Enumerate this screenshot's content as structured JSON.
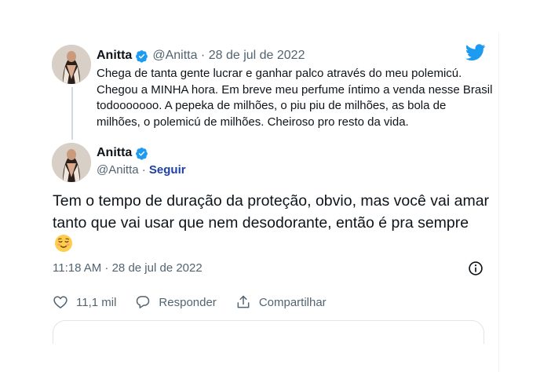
{
  "colors": {
    "accent": "#1d9bf0",
    "text": "#0f1419",
    "muted": "#536471",
    "link": "#1d3fa8"
  },
  "parent_tweet": {
    "author_name": "Anitta",
    "handle_date": "@Anitta · 28 de jul de 2022",
    "text": "Chega de tanta gente lucrar e ganhar palco através do meu polemicú. Chegou a MINHA hora. Em breve meu perfume íntimo a venda nesse Brasil todooooooo. A pepeka de milhões, o piu piu de milhões, as bola de milhões, o polemicú de milhões. Cheiroso pro resto da vida."
  },
  "main_tweet": {
    "author_name": "Anitta",
    "handle": "@Anitta · ",
    "follow_label": "Seguir",
    "text": "Tem o tempo de duração da proteção, obvio, mas você vai amar tanto que vai usar que nem desodorante, então é pra sempre",
    "emoji": "relieved-face",
    "timestamp": "11:18 AM · 28 de jul de 2022",
    "likes": "11,1 mil",
    "reply_label": "Responder",
    "share_label": "Compartilhar"
  },
  "icons": {
    "brand": "twitter-bird-icon",
    "verified": "verified-badge-icon",
    "info": "info-icon",
    "like": "heart-icon",
    "reply": "reply-bubble-icon",
    "share": "share-icon"
  }
}
